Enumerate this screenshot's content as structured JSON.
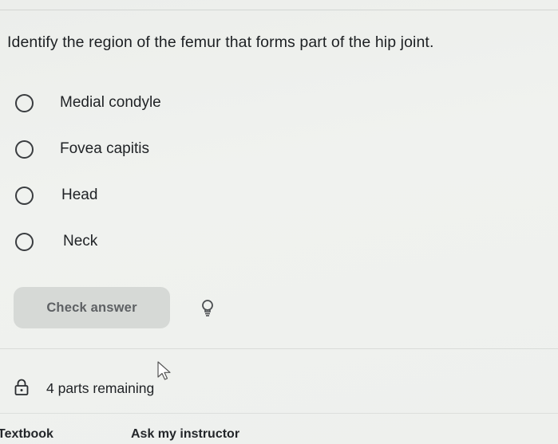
{
  "question": {
    "text": "Identify the region of the femur that forms part of the hip joint."
  },
  "options": [
    {
      "label": "Medial condyle",
      "selected": false
    },
    {
      "label": "Fovea capitis",
      "selected": false
    },
    {
      "label": "Head",
      "selected": false
    },
    {
      "label": "Neck",
      "selected": false
    }
  ],
  "actions": {
    "check_answer_label": "Check answer",
    "hint_icon": "lightbulb-icon"
  },
  "status": {
    "lock_icon": "lock-icon",
    "parts_remaining": "4 parts remaining"
  },
  "footer": {
    "textbook_label": "Textbook",
    "ask_instructor_label": "Ask my instructor"
  },
  "colors": {
    "background": "#eef0ed",
    "button_bg": "#d6d9d6",
    "button_text": "#5e6164",
    "text": "#1f2224"
  }
}
